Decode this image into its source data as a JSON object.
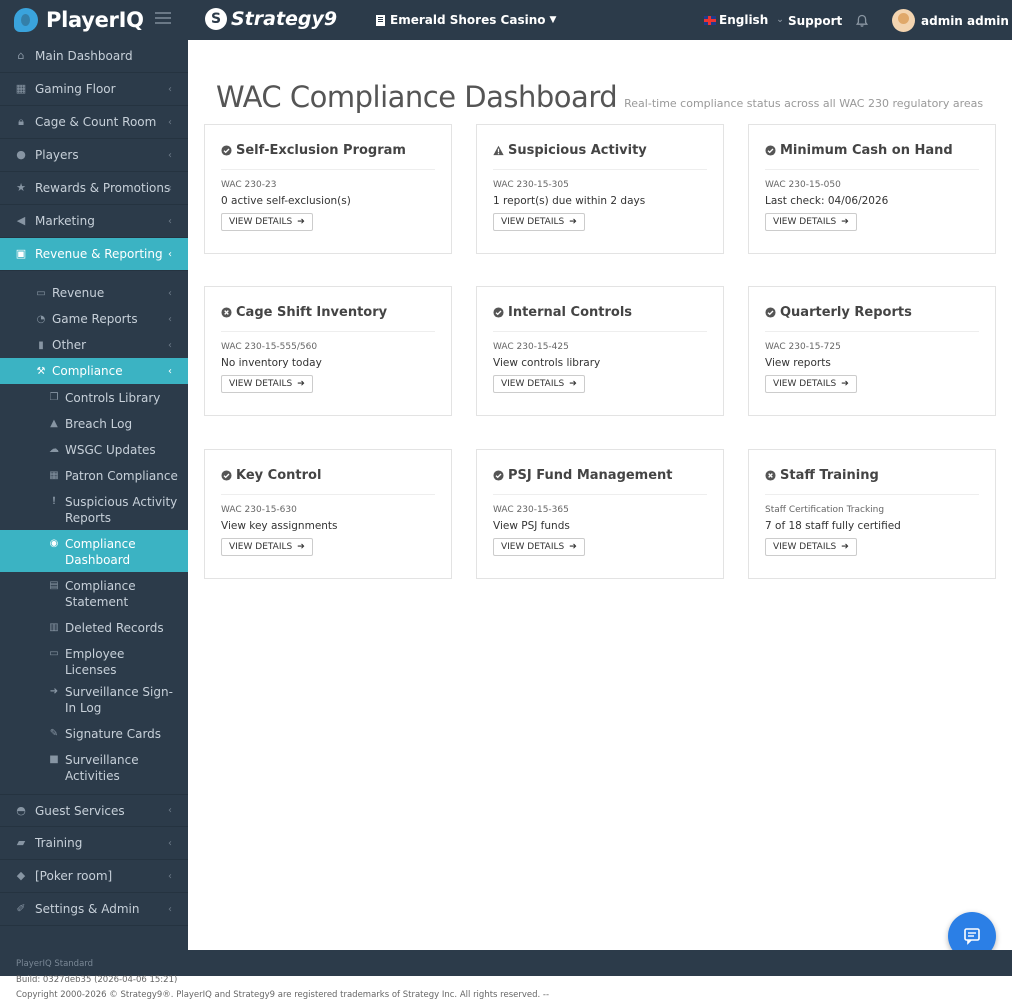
{
  "topbar": {
    "brand": "PlayerIQ",
    "partner": "Strategy9",
    "casino": "Emerald Shores Casino",
    "language": "English",
    "support": "Support",
    "user": "admin admin"
  },
  "sidebar": {
    "items": [
      {
        "label": "Main Dashboard",
        "icon": "home-icon"
      },
      {
        "label": "Gaming Floor",
        "icon": "table-icon"
      },
      {
        "label": "Cage & Count Room",
        "icon": "lock-icon"
      },
      {
        "label": "Players",
        "icon": "user-icon"
      },
      {
        "label": "Rewards & Promotions",
        "icon": "star-icon"
      },
      {
        "label": "Marketing",
        "icon": "bullhorn-icon"
      },
      {
        "label": "Revenue & Reporting",
        "icon": "money-icon"
      }
    ],
    "revenue_sub": [
      {
        "label": "Revenue",
        "icon": "money-icon"
      },
      {
        "label": "Game Reports",
        "icon": "pie-chart-icon"
      },
      {
        "label": "Other",
        "icon": "file-icon"
      },
      {
        "label": "Compliance",
        "icon": "gavel-icon"
      }
    ],
    "compliance_sub": [
      {
        "label": "Controls Library",
        "icon": "files-icon"
      },
      {
        "label": "Breach Log",
        "icon": "warning-icon"
      },
      {
        "label": "WSGC Updates",
        "icon": "cloud-icon"
      },
      {
        "label": "Patron Compliance",
        "icon": "table-icon"
      },
      {
        "label": "Suspicious Activity Reports",
        "icon": "exclamation-icon"
      },
      {
        "label": "Compliance Dashboard",
        "icon": "dashboard-icon"
      },
      {
        "label": "Compliance Statement",
        "icon": "file-text-icon"
      },
      {
        "label": "Deleted Records",
        "icon": "trash-icon"
      },
      {
        "label": "Employee Licenses",
        "icon": "id-card-icon"
      },
      {
        "label": "Surveillance Sign-In Log",
        "icon": "sign-in-icon"
      },
      {
        "label": "Signature Cards",
        "icon": "edit-icon"
      },
      {
        "label": "Surveillance Activities",
        "icon": "video-icon"
      }
    ],
    "bottom_items": [
      {
        "label": "Guest Services",
        "icon": "concierge-icon"
      },
      {
        "label": "Training",
        "icon": "graduation-icon"
      },
      {
        "label": "[Poker room]",
        "icon": "diamond-icon"
      },
      {
        "label": "Settings & Admin",
        "icon": "wrench-icon"
      }
    ]
  },
  "page": {
    "title": "WAC Compliance Dashboard",
    "subtitle": "Real-time compliance status across all WAC 230 regulatory areas"
  },
  "cards": [
    {
      "title": "Self-Exclusion Program",
      "status_icon": "check-circle-icon",
      "code": "WAC 230-23",
      "status": "0 active self-exclusion(s)",
      "button": "VIEW DETAILS"
    },
    {
      "title": "Suspicious Activity",
      "status_icon": "warning-icon",
      "code": "WAC 230-15-305",
      "status": "1 report(s) due within 2 days",
      "button": "VIEW DETAILS"
    },
    {
      "title": "Minimum Cash on Hand",
      "status_icon": "check-circle-icon",
      "code": "WAC 230-15-050",
      "status": "Last check: 04/06/2026",
      "button": "VIEW DETAILS"
    },
    {
      "title": "Cage Shift Inventory",
      "status_icon": "times-circle-icon",
      "code": "WAC 230-15-555/560",
      "status": "No inventory today",
      "button": "VIEW DETAILS"
    },
    {
      "title": "Internal Controls",
      "status_icon": "check-circle-icon",
      "code": "WAC 230-15-425",
      "status": "View controls library",
      "button": "VIEW DETAILS"
    },
    {
      "title": "Quarterly Reports",
      "status_icon": "check-circle-icon",
      "code": "WAC 230-15-725",
      "status": "View reports",
      "button": "VIEW DETAILS"
    },
    {
      "title": "Key Control",
      "status_icon": "check-circle-icon",
      "code": "WAC 230-15-630",
      "status": "View key assignments",
      "button": "VIEW DETAILS"
    },
    {
      "title": "PSJ Fund Management",
      "status_icon": "check-circle-icon",
      "code": "WAC 230-15-365",
      "status": "View PSJ funds",
      "button": "VIEW DETAILS"
    },
    {
      "title": "Staff Training",
      "status_icon": "times-circle-icon",
      "code": "Staff Certification Tracking",
      "status": "7 of 18 staff fully certified",
      "button": "VIEW DETAILS"
    }
  ],
  "footer": {
    "version": "PlayerIQ Standard",
    "build": "Build: 0327deb35 (2026-04-06 15:21)",
    "copyright": "Copyright 2000-2026 © Strategy9®. PlayerIQ and Strategy9 are registered trademarks of Strategy Inc. All rights reserved. --"
  },
  "colors": {
    "sidebar_bg": "#2c3b4a",
    "active": "#3bb3c3",
    "fab": "#2b7fe6"
  }
}
